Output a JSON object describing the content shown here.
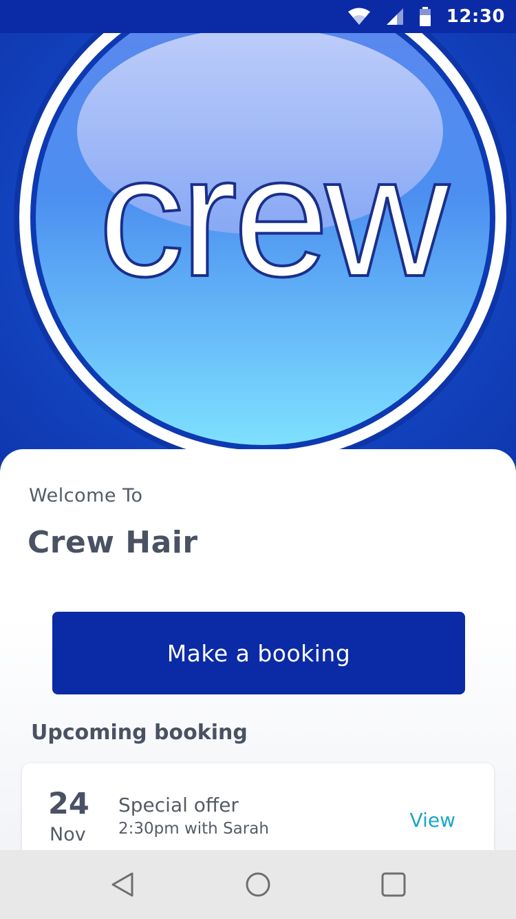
{
  "status_bar": {
    "time": "12:30",
    "icons": [
      "wifi-icon",
      "signal-icon",
      "battery-icon"
    ]
  },
  "hero": {
    "logo_text": "crew",
    "colors": {
      "background": "#1446c4",
      "badge_top": "#b8c8f8",
      "badge_bottom": "#7ee0ff",
      "ring": "#ffffff"
    }
  },
  "welcome": {
    "greeting": "Welcome To",
    "business_name": "Crew Hair"
  },
  "booking_button": {
    "label": "Make a booking",
    "color": "#0b2aa6"
  },
  "upcoming": {
    "heading": "Upcoming booking",
    "item": {
      "day": "24",
      "month": "Nov",
      "title": "Special offer",
      "detail": "2:30pm with Sarah",
      "action_label": "View"
    }
  },
  "nav_bar": {
    "buttons": [
      "back-icon",
      "home-icon",
      "recents-icon"
    ]
  }
}
